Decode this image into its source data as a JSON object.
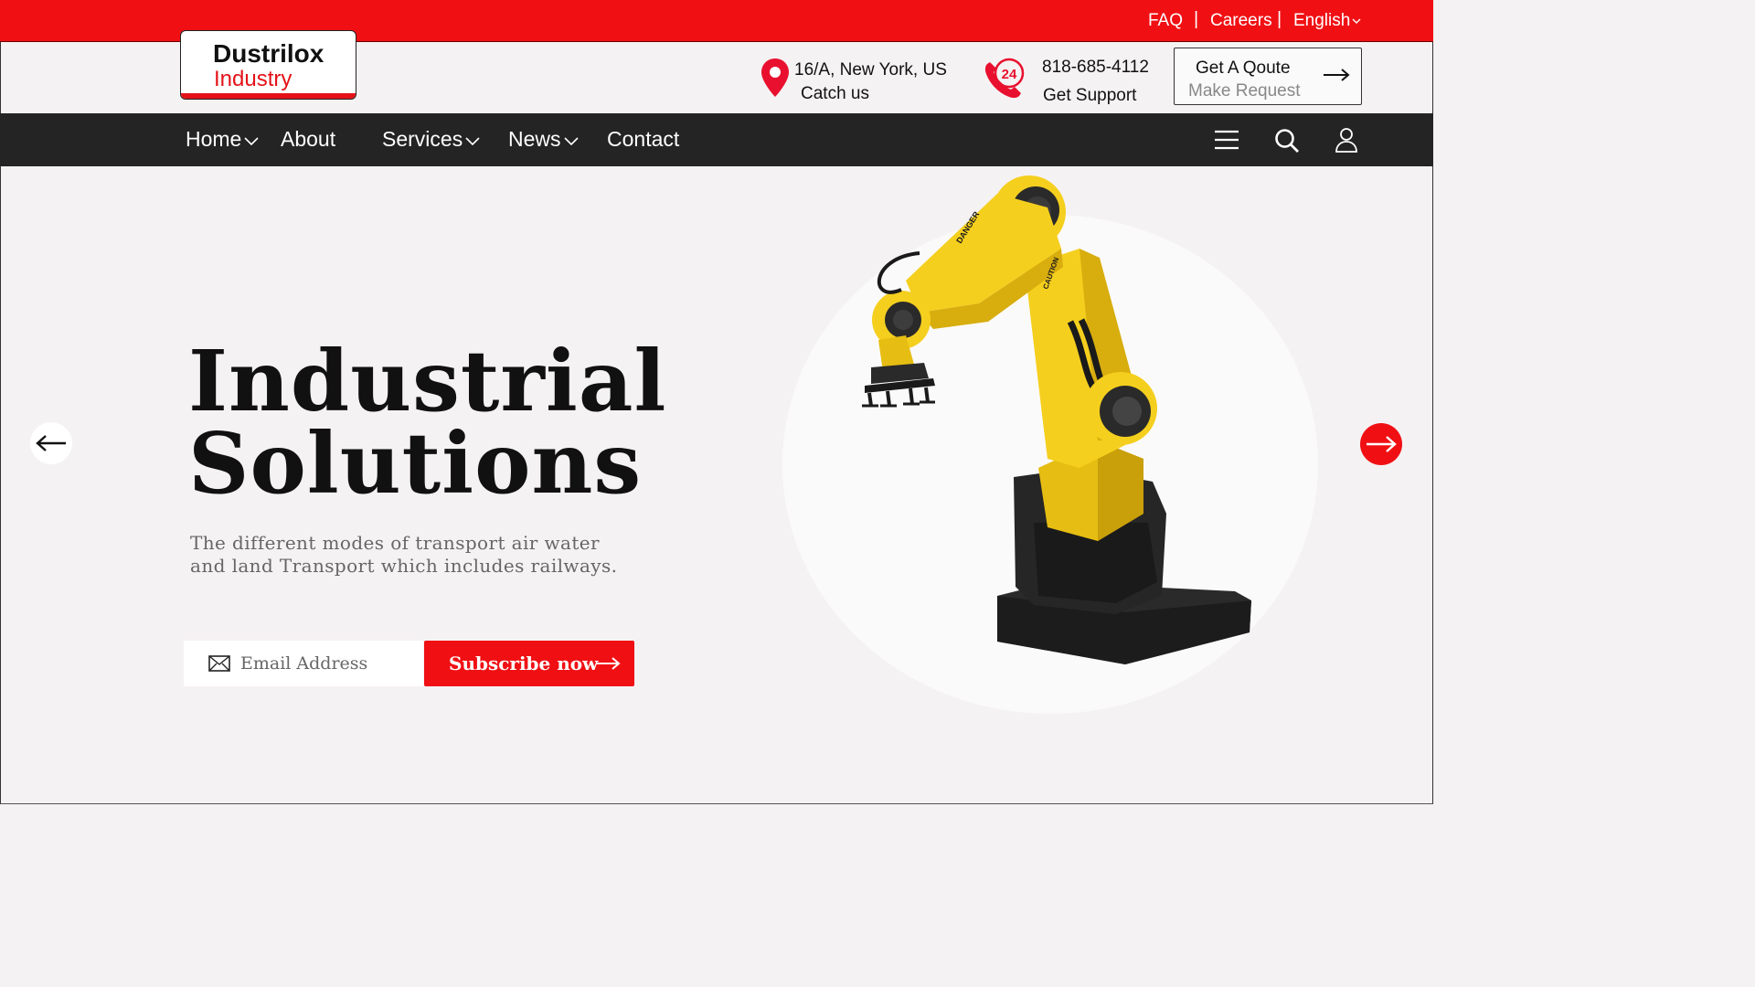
{
  "topbar": {
    "faq": "FAQ",
    "separator": "|",
    "careers": "Careers",
    "language": "English"
  },
  "logo": {
    "line1": "Dustrilox",
    "line2": "Industry"
  },
  "contact": {
    "address": "16/A, New York, US",
    "address_sub": "Catch us",
    "support_badge": "24",
    "phone": "818-685-4112",
    "phone_sub": "Get Support"
  },
  "quote": {
    "title": "Get A Qoute",
    "subtitle": "Make Request"
  },
  "nav": {
    "items": [
      "Home",
      "About",
      "Services",
      "News",
      "Contact"
    ]
  },
  "hero": {
    "title_line1": "Industrial",
    "title_line2": "Solutions",
    "description": "The different modes of transport air water and land Transport which includes railways.",
    "email_placeholder": "Email Address",
    "subscribe_label": "Subscribe now",
    "robot_label_1": "DANGER",
    "robot_label_2": "CAUTION"
  },
  "colors": {
    "brand_red": "#f01014",
    "nav_bg": "#242424",
    "robot_yellow": "#f5cf1e"
  }
}
